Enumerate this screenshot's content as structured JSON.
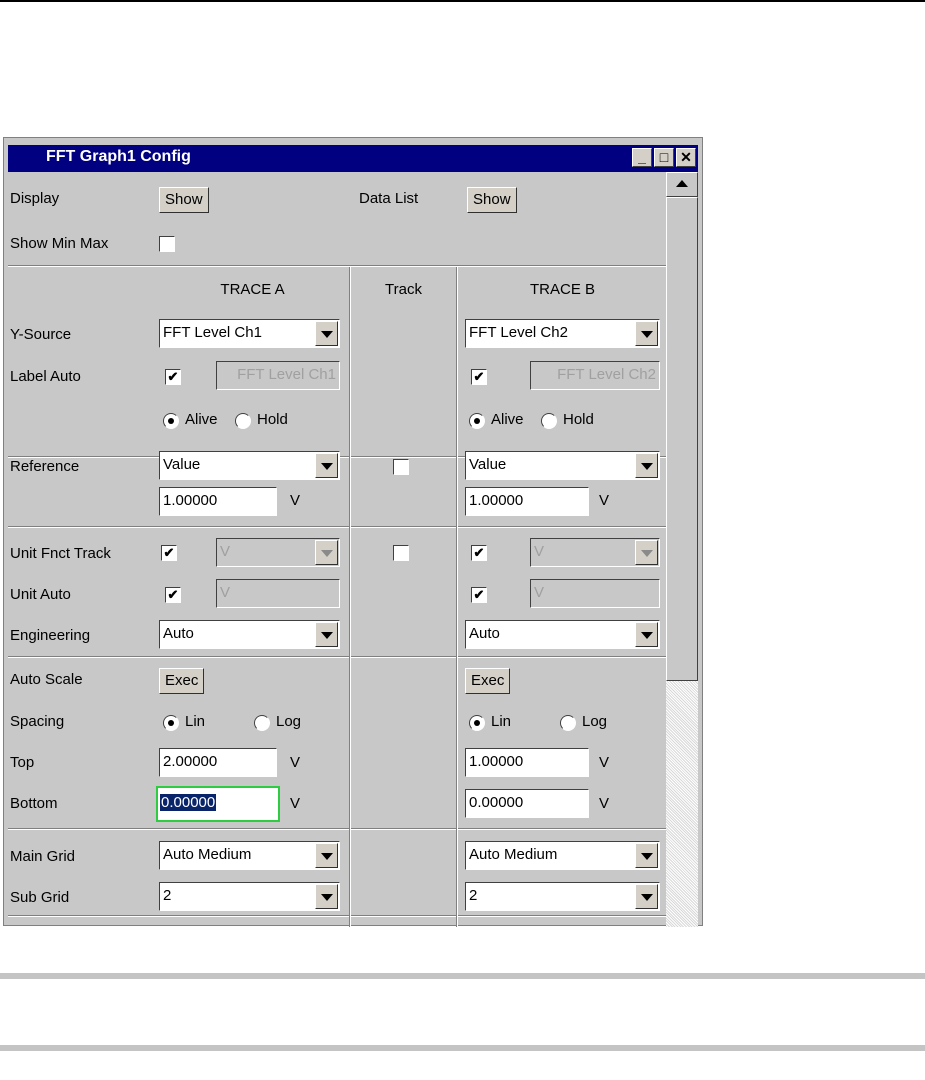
{
  "window": {
    "title": "FFT Graph1 Config",
    "minimize": "_",
    "maximize": "□",
    "close": "✕"
  },
  "row_display": {
    "display_label": "Display",
    "display_button": "Show",
    "datalist_label": "Data List",
    "datalist_button": "Show"
  },
  "row_showminmax": {
    "label": "Show Min Max",
    "checked": false
  },
  "headers": {
    "trace_a": "TRACE A",
    "track": "Track",
    "trace_b": "TRACE B"
  },
  "labels": {
    "y_source": "Y-Source",
    "label_auto": "Label Auto",
    "reference": "Reference",
    "unit_fnct_track": "Unit Fnct Track",
    "unit_auto": "Unit Auto",
    "engineering": "Engineering",
    "auto_scale": "Auto Scale",
    "spacing": "Spacing",
    "top": "Top",
    "bottom": "Bottom",
    "main_grid": "Main Grid",
    "sub_grid": "Sub Grid"
  },
  "trace_a": {
    "y_source": "FFT Level Ch1",
    "label_auto_checked": true,
    "label_text": "FFT Level Ch1",
    "alive": "Alive",
    "hold": "Hold",
    "mode": "Alive",
    "reference_type": "Value",
    "reference_value": "1.00000",
    "reference_unit": "V",
    "unit_fnct_track_checked": true,
    "unit_fnct_value": "V",
    "unit_auto_checked": true,
    "unit_value": "V",
    "engineering": "Auto",
    "auto_scale_button": "Exec",
    "spacing_lin": "Lin",
    "spacing_log": "Log",
    "spacing": "Lin",
    "top_value": "2.00000",
    "top_unit": "V",
    "bottom_value": "0.00000",
    "bottom_unit": "V",
    "main_grid": "Auto Medium",
    "sub_grid": "2"
  },
  "track": {
    "reference_checked": false,
    "unit_fnct_checked": false
  },
  "trace_b": {
    "y_source": "FFT Level Ch2",
    "label_auto_checked": true,
    "label_text": "FFT Level Ch2",
    "alive": "Alive",
    "hold": "Hold",
    "mode": "Alive",
    "reference_type": "Value",
    "reference_value": "1.00000",
    "reference_unit": "V",
    "unit_fnct_track_checked": true,
    "unit_fnct_value": "V",
    "unit_auto_checked": true,
    "unit_value": "V",
    "engineering": "Auto",
    "auto_scale_button": "Exec",
    "spacing_lin": "Lin",
    "spacing_log": "Log",
    "spacing": "Lin",
    "top_value": "1.00000",
    "top_unit": "V",
    "bottom_value": "0.00000",
    "bottom_unit": "V",
    "main_grid": "Auto Medium",
    "sub_grid": "2"
  },
  "check_glyph": "✔",
  "colors": {
    "title_bar": "#000080",
    "panel": "#c8c8c8",
    "focus_border": "#2ecc40",
    "selection": "#0a246a"
  }
}
